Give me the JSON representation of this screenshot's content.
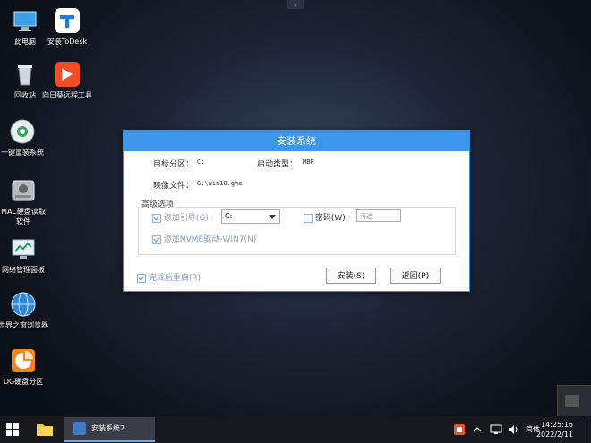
{
  "desktop": {
    "icons": [
      {
        "label": "此电脑",
        "icon": "computer-icon"
      },
      {
        "label": "安装ToDesk",
        "icon": "todesk-icon"
      },
      {
        "label": "回收站",
        "icon": "recycle-bin-icon"
      },
      {
        "label": "向日葵远程工具",
        "icon": "sunflower-icon"
      },
      {
        "label": "一键重装系统",
        "icon": "reinstall-icon"
      },
      {
        "label": "MAC硬盘读取软件",
        "icon": "mac-disk-icon"
      },
      {
        "label": "网络管理面板",
        "icon": "network-panel-icon"
      },
      {
        "label": "世界之窗浏览器",
        "icon": "browser-icon"
      },
      {
        "label": "DG硬盘分区",
        "icon": "diskgenius-icon"
      }
    ]
  },
  "dialog": {
    "title": "安装系统",
    "target_label": "目标分区：",
    "target_value": "C:",
    "boot_label": "启动类型：",
    "boot_value": "MBR",
    "image_label": "映像文件：",
    "image_value": "G:\\win10.gho",
    "advanced_title": "高级选项",
    "add_boot_label": "添加引导(G):",
    "add_boot_checked": true,
    "boot_drive_value": "C:",
    "password_label": "密码(W):",
    "password_checked": false,
    "password_placeholder": "可选",
    "nvme_label": "添加NVME驱动-WIN7(N)",
    "nvme_checked": true,
    "reboot_label": "完成后重启(R)",
    "reboot_checked": true,
    "install_button": "安装(S)",
    "back_button": "返回(P)"
  },
  "taskbar": {
    "active_app": "安装系统2",
    "ime": "简体",
    "time": "14:25:16",
    "date": "2022/2/11"
  },
  "colors": {
    "accent": "#3d96ea",
    "taskbar": "#16181e"
  }
}
